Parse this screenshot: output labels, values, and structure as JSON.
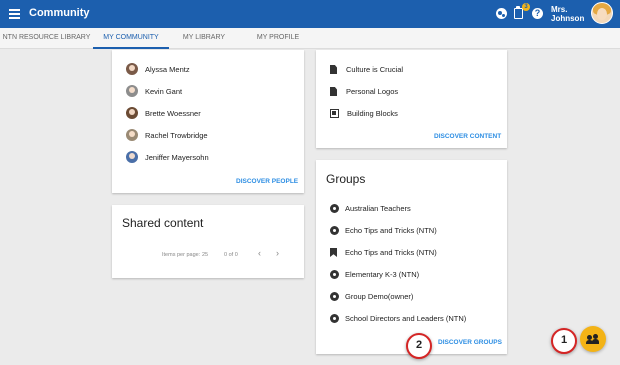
{
  "appbar": {
    "title": "Community",
    "notification_count": "3",
    "help_glyph": "?",
    "user_name_line1": "Mrs.",
    "user_name_line2": "Johnson",
    "color": "#1c5fae"
  },
  "tabs": [
    {
      "label": "NTN RESOURCE LIBRARY",
      "active": false
    },
    {
      "label": "MY COMMUNITY",
      "active": true
    },
    {
      "label": "MY LIBRARY",
      "active": false
    },
    {
      "label": "MY PROFILE",
      "active": false
    }
  ],
  "people_card": {
    "people": [
      "Alyssa Mentz",
      "Kevin Gant",
      "Brette Woessner",
      "Rachel Trowbridge",
      "Jeniffer Mayersohn"
    ],
    "discover_label": "DISCOVER PEOPLE"
  },
  "content_card": {
    "items": [
      {
        "label": "Culture is Crucial",
        "icon": "document-icon"
      },
      {
        "label": "Personal Logos",
        "icon": "document-icon"
      },
      {
        "label": "Building Blocks",
        "icon": "library-icon"
      }
    ],
    "discover_label": "DISCOVER CONTENT"
  },
  "shared_card": {
    "title": "Shared content",
    "items_per_page_label": "Items per page:",
    "items_per_page_value": "25",
    "range": "0 of 0",
    "prev_glyph": "‹",
    "next_glyph": "›"
  },
  "groups_card": {
    "title": "Groups",
    "groups": [
      {
        "label": "Australian Teachers",
        "icon": "group-icon"
      },
      {
        "label": "Echo Tips and Tricks (NTN)",
        "icon": "group-icon"
      },
      {
        "label": "Echo Tips and Tricks (NTN)",
        "icon": "bookmark-icon"
      },
      {
        "label": "Elementary K-3 (NTN)",
        "icon": "group-icon"
      },
      {
        "label": "Group Demo(owner)",
        "icon": "group-icon"
      },
      {
        "label": "School Directors and Leaders (NTN)",
        "icon": "group-icon"
      }
    ],
    "discover_label": "DISCOVER GROUPS"
  },
  "callouts": [
    "1",
    "2"
  ],
  "fab_icon": "add-group-icon",
  "accent_link_color": "#2d8ee3",
  "fab_color": "#f3b316"
}
